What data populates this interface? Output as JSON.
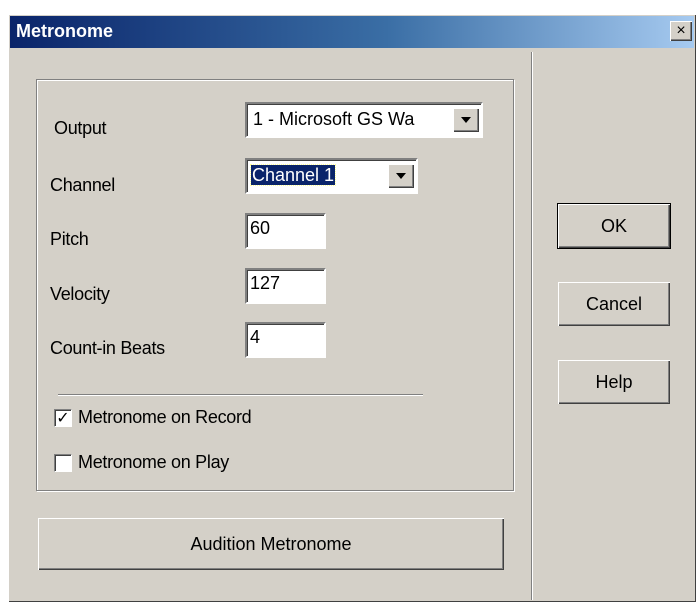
{
  "window": {
    "title": "Metronome",
    "close_glyph": "×"
  },
  "fields": {
    "output": {
      "label": "Output",
      "value": "1 - Microsoft GS Wa"
    },
    "channel": {
      "label": "Channel",
      "value": "Channel 1"
    },
    "pitch": {
      "label": "Pitch",
      "value": "60"
    },
    "velocity": {
      "label": "Velocity",
      "value": "127"
    },
    "count_in": {
      "label": "Count-in Beats",
      "value": "4"
    }
  },
  "checkboxes": {
    "on_record": {
      "label": "Metronome on Record",
      "checked": true,
      "mark": "✓"
    },
    "on_play": {
      "label": "Metronome on Play",
      "checked": false
    }
  },
  "buttons": {
    "ok": "OK",
    "cancel": "Cancel",
    "help": "Help",
    "audition": "Audition Metronome"
  },
  "colors": {
    "face": "#d4d0c8",
    "title_start": "#0a246a",
    "title_end": "#a6caf0",
    "selection": "#0a246a"
  }
}
